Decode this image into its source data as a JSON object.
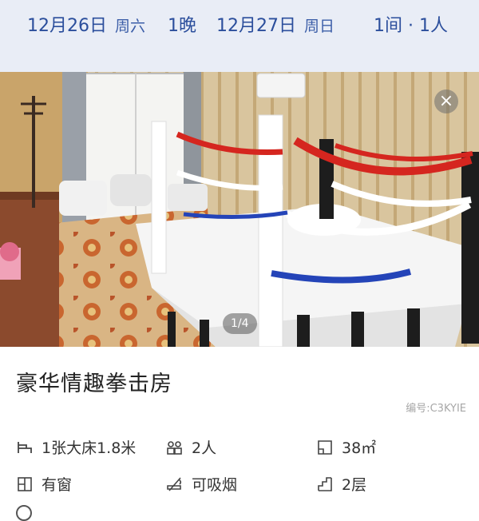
{
  "header": {
    "checkin_date": "12月26日",
    "checkin_weekday": "周六",
    "nights": "1晚",
    "checkout_date": "12月27日",
    "checkout_weekday": "周日",
    "rooms_guests": "1间 · 1人"
  },
  "gallery": {
    "counter": "1/4",
    "close_symbol": "×"
  },
  "room": {
    "name": "豪华情趣拳击房",
    "code": "编号:C3KYIE"
  },
  "features": [
    {
      "icon": "bed-icon",
      "label": "1张大床1.8米"
    },
    {
      "icon": "people-icon",
      "label": "2人"
    },
    {
      "icon": "area-icon",
      "label": "38㎡"
    },
    {
      "icon": "window-icon",
      "label": "有窗"
    },
    {
      "icon": "smoking-icon",
      "label": "可吸烟"
    },
    {
      "icon": "floor-icon",
      "label": "2层"
    }
  ],
  "colors": {
    "accent": "#2b4e9c",
    "header_bg": "#e9edf6"
  }
}
